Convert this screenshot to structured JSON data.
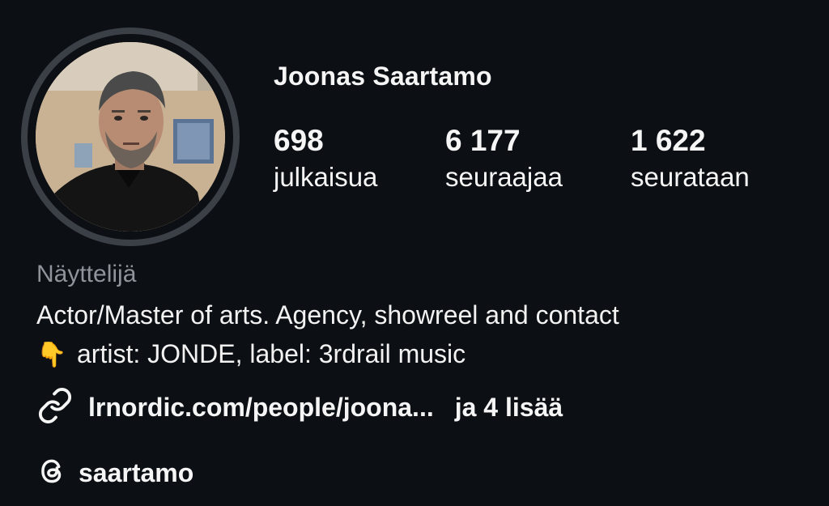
{
  "profile": {
    "name": "Joonas Saartamo",
    "stats": {
      "posts": {
        "value": "698",
        "label": "julkaisua"
      },
      "followers": {
        "value": "6 177",
        "label": "seuraajaa"
      },
      "following": {
        "value": "1 622",
        "label": "seurataan"
      }
    },
    "category": "Näyttelijä",
    "bio": {
      "line1": "Actor/Master of arts. Agency, showreel and contact",
      "line2_emoji": "👇",
      "line2_text": "artist: JONDE, label: 3rdrail music"
    },
    "link": {
      "icon": "link-icon",
      "text": "lrnordic.com/people/joona...",
      "more": "ja 4 lisää"
    },
    "threads": {
      "icon": "threads-icon",
      "handle": "saartamo"
    }
  },
  "colors": {
    "background": "#0c0f14",
    "text": "#f5f5f5",
    "muted": "#8f949b",
    "avatar_ring": "#3b3f46"
  }
}
